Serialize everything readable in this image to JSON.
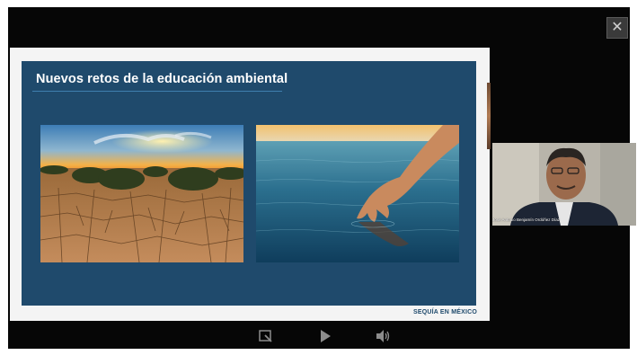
{
  "viewer": {
    "close_label": "✕"
  },
  "slide": {
    "title": "Nuevos retos de la educación ambiental",
    "brand": "SEQUÍA EN MÉXICO",
    "colors": {
      "background": "#1f4a6c",
      "frame": "#f4f4f4",
      "accent_line": "#3f7fae"
    }
  },
  "participant": {
    "name": "José Antonio Benjamín Ordóñez Díaz"
  },
  "controls": [
    {
      "icon": "annotate-icon"
    },
    {
      "icon": "play-icon"
    },
    {
      "icon": "volume-icon"
    }
  ]
}
